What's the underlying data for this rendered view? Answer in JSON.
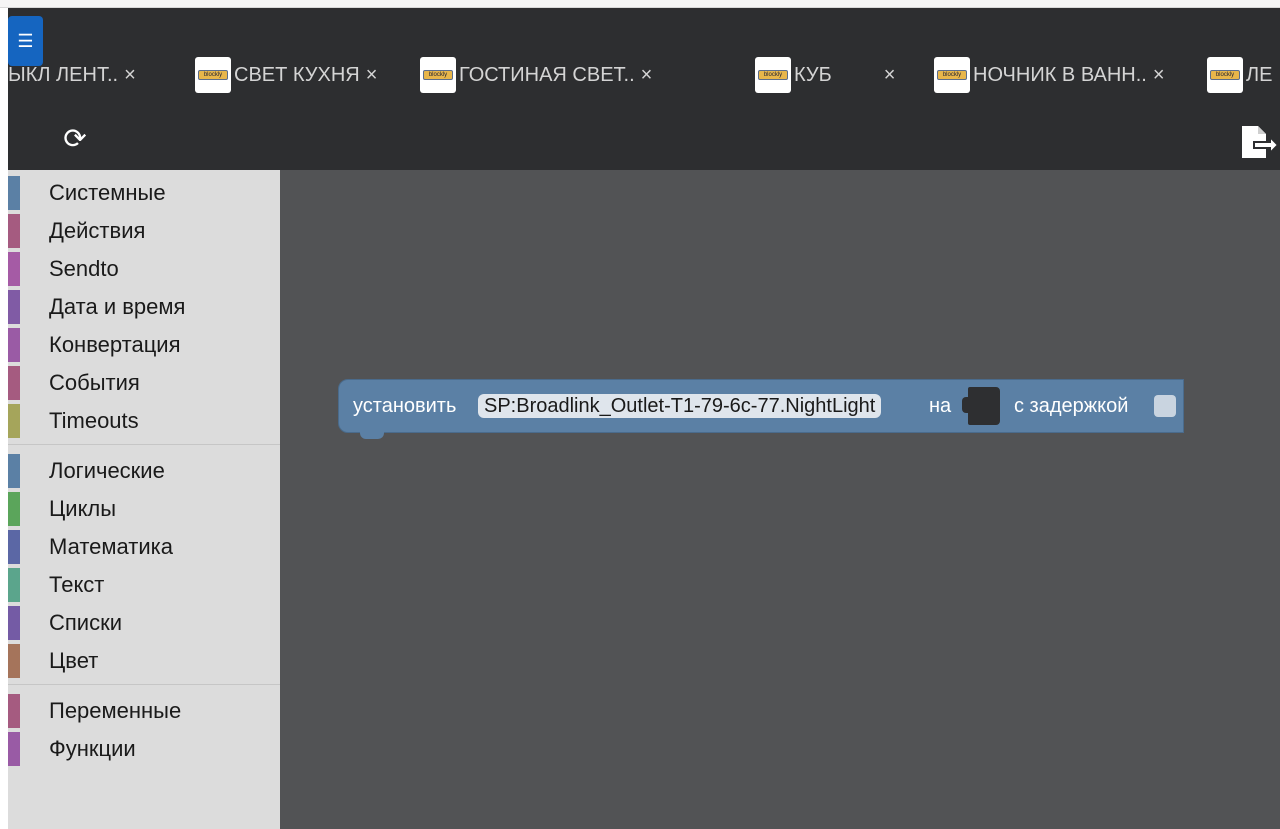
{
  "tabs": [
    {
      "label": "ЫКЛ ЛЕНТ..",
      "close": "×",
      "has_logo": false
    },
    {
      "label": "СВЕТ КУХНЯ",
      "close": "×",
      "has_logo": true
    },
    {
      "label": "ГОСТИНАЯ СВЕТ..",
      "close": "×",
      "has_logo": true
    },
    {
      "label": "КУБ",
      "close": "×",
      "has_logo": true
    },
    {
      "label": "НОЧНИК В ВАНН..",
      "close": "×",
      "has_logo": true
    },
    {
      "label": "ЛЕ",
      "close": "",
      "has_logo": true
    }
  ],
  "tab_logo_text": "blockly",
  "toolbar": {
    "refresh_icon": "refresh-icon",
    "export_icon": "export-file-icon"
  },
  "categories_group1": [
    {
      "label": "Системные",
      "color": "#5b80a5"
    },
    {
      "label": "Действия",
      "color": "#a55b80"
    },
    {
      "label": "Sendto",
      "color": "#a55ba5"
    },
    {
      "label": "Дата и время",
      "color": "#805ba5"
    },
    {
      "label": "Конвертация",
      "color": "#9a5ba5"
    },
    {
      "label": "События",
      "color": "#a55b80"
    },
    {
      "label": "Timeouts",
      "color": "#a5a55b"
    }
  ],
  "categories_group2": [
    {
      "label": "Логические",
      "color": "#5b80a5"
    },
    {
      "label": "Циклы",
      "color": "#5ba55b"
    },
    {
      "label": "Математика",
      "color": "#5b67a5"
    },
    {
      "label": "Текст",
      "color": "#5ba58c"
    },
    {
      "label": "Списки",
      "color": "#745ba5"
    },
    {
      "label": "Цвет",
      "color": "#a5745b"
    }
  ],
  "categories_group3": [
    {
      "label": "Переменные",
      "color": "#a55b80"
    },
    {
      "label": "Функции",
      "color": "#995ba5"
    }
  ],
  "block": {
    "prefix": "установить",
    "object_id": "SP:Broadlink_Outlet-T1-79-6c-77.NightLight",
    "to_label": "на",
    "delay_label": "с задержкой",
    "color": "#5b80a5"
  }
}
